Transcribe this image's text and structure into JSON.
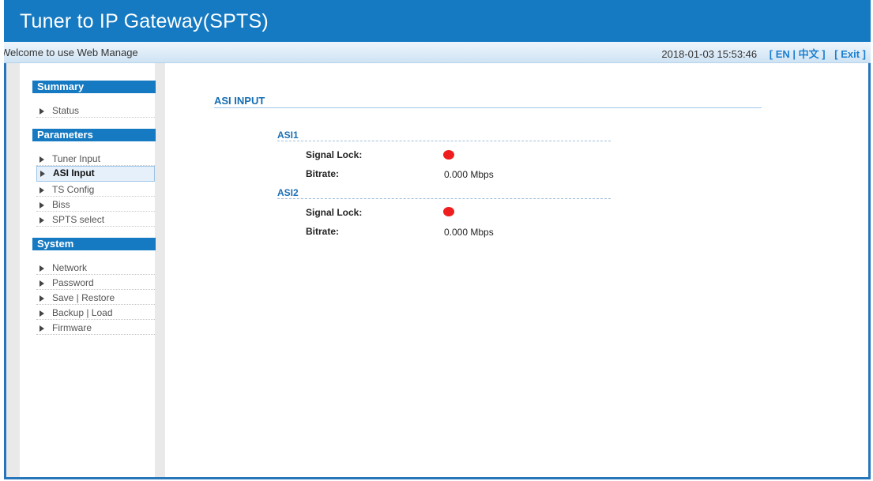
{
  "header": {
    "title": "Tuner to IP Gateway(SPTS)"
  },
  "topbar": {
    "welcome": "Welcome to use Web Manage",
    "datetime": "2018-01-03 15:53:46",
    "lang_open": "[ ",
    "lang_en": "EN",
    "lang_sep": " | ",
    "lang_zh": "中文",
    "lang_close": " ]",
    "exit": "[ Exit ]"
  },
  "sidebar": {
    "summary": {
      "title": "Summary",
      "items": [
        "Status"
      ]
    },
    "parameters": {
      "title": "Parameters",
      "items": [
        "Tuner Input",
        "ASI Input",
        "TS Config",
        "Biss",
        "SPTS select"
      ]
    },
    "system": {
      "title": "System",
      "items": [
        "Network",
        "Password",
        "Save | Restore",
        "Backup | Load",
        "Firmware"
      ]
    }
  },
  "main": {
    "title": "ASI INPUT",
    "groups": [
      {
        "name": "ASI1",
        "signal_label": "Signal Lock:",
        "signal_status": "unlocked",
        "signal_color": "#ef1d1d",
        "bitrate_label": "Bitrate:",
        "bitrate": "0.000 Mbps"
      },
      {
        "name": "ASI2",
        "signal_label": "Signal Lock:",
        "signal_status": "unlocked",
        "signal_color": "#ef1d1d",
        "bitrate_label": "Bitrate:",
        "bitrate": "0.000 Mbps"
      }
    ]
  },
  "colors": {
    "accent": "#157ac2",
    "link": "#1a7fd0",
    "led_off": "#ef1d1d"
  },
  "icons": {
    "nav_arrow": "triangle-right-icon",
    "signal": "status-dot-icon"
  }
}
